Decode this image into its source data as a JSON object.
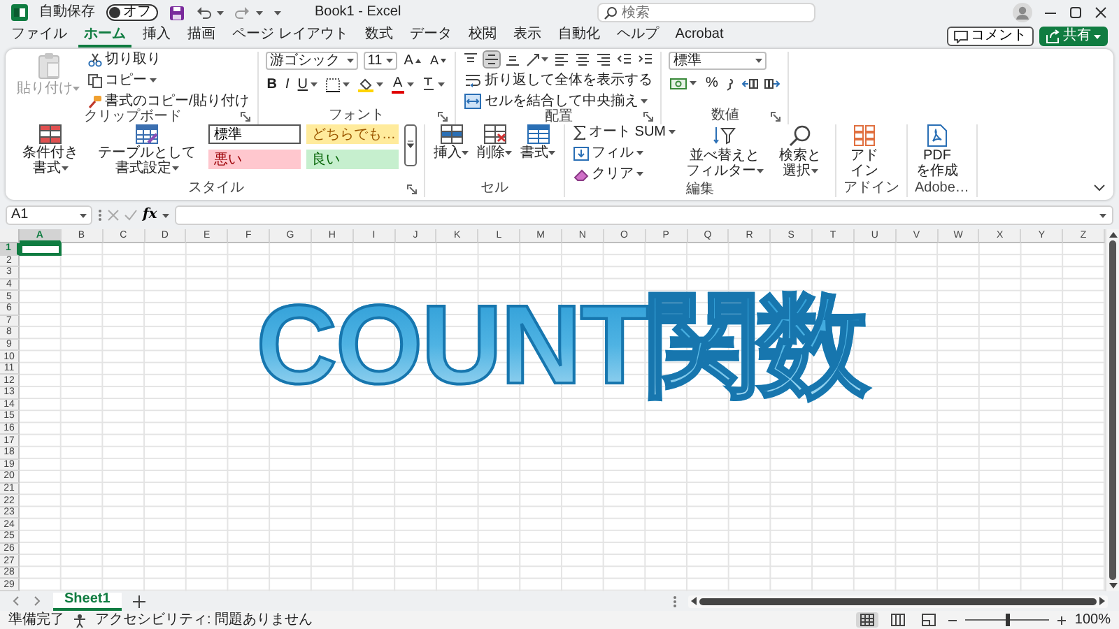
{
  "title_bar": {
    "autosave_label": "自動保存",
    "autosave": {
      "label": "オフ",
      "on": false
    },
    "document_title": "Book1 - Excel",
    "search": {
      "placeholder": "検索"
    }
  },
  "ribbon_tabs": [
    {
      "label": "ファイル",
      "selected": false
    },
    {
      "label": "ホーム",
      "selected": true
    },
    {
      "label": "挿入",
      "selected": false
    },
    {
      "label": "描画",
      "selected": false
    },
    {
      "label": "ページ レイアウト",
      "selected": false
    },
    {
      "label": "数式",
      "selected": false
    },
    {
      "label": "データ",
      "selected": false
    },
    {
      "label": "校閲",
      "selected": false
    },
    {
      "label": "表示",
      "selected": false
    },
    {
      "label": "自動化",
      "selected": false
    },
    {
      "label": "ヘルプ",
      "selected": false
    },
    {
      "label": "Acrobat",
      "selected": false
    }
  ],
  "ribbon_actions": {
    "comment": "コメント",
    "share": "共有"
  },
  "ribbon": {
    "clipboard": {
      "label": "クリップボード",
      "paste": {
        "label": "貼り付け",
        "disabled": true
      },
      "cut": "切り取り",
      "copy": "コピー",
      "format_painter": "書式のコピー/貼り付け"
    },
    "font": {
      "label": "フォント",
      "font_name": "游ゴシック",
      "font_size": "11",
      "grow": "A",
      "shrink": "A",
      "bold": "B",
      "italic": "I",
      "underline": "U",
      "font_color": "A"
    },
    "alignment": {
      "label": "配置",
      "vertical_align": [
        {
          "selected": false
        },
        {
          "selected": true
        },
        {
          "selected": false
        }
      ],
      "wrap_text": "折り返して全体を表示する",
      "merge_center": "セルを結合して中央揃え"
    },
    "number": {
      "label": "数値",
      "format": "標準",
      "percent": "%"
    },
    "styles": {
      "label": "スタイル",
      "conditional": "条件付き書式",
      "format_table": "テーブルとして書式設定",
      "cell_styles": [
        {
          "label": "標準",
          "kind": "normal"
        },
        {
          "label": "どちらでも…",
          "kind": "neutral"
        },
        {
          "label": "悪い",
          "kind": "bad"
        },
        {
          "label": "良い",
          "kind": "good"
        }
      ]
    },
    "cells": {
      "label": "セル",
      "insert": "挿入",
      "delete": "削除",
      "format": "書式"
    },
    "editing": {
      "label": "編集",
      "autosum": "オート SUM",
      "fill": "フィル",
      "clear": "クリア",
      "sort_filter": "並べ替えとフィルター",
      "find_select": "検索と選択"
    },
    "addins": {
      "label": "アドイン",
      "button": "アドイン"
    },
    "adobe": {
      "label": "Adobe…",
      "button": "PDF\nを作成"
    }
  },
  "formula_bar": {
    "name_box": "A1",
    "function_label": "fx"
  },
  "sheet": {
    "columns": [
      {
        "label": "A",
        "selected": true
      },
      {
        "label": "B",
        "selected": false
      },
      {
        "label": "C",
        "selected": false
      },
      {
        "label": "D",
        "selected": false
      },
      {
        "label": "E",
        "selected": false
      },
      {
        "label": "F",
        "selected": false
      },
      {
        "label": "G",
        "selected": false
      },
      {
        "label": "H",
        "selected": false
      },
      {
        "label": "I",
        "selected": false
      },
      {
        "label": "J",
        "selected": false
      },
      {
        "label": "K",
        "selected": false
      },
      {
        "label": "L",
        "selected": false
      },
      {
        "label": "M",
        "selected": false
      },
      {
        "label": "N",
        "selected": false
      },
      {
        "label": "O",
        "selected": false
      },
      {
        "label": "P",
        "selected": false
      },
      {
        "label": "Q",
        "selected": false
      },
      {
        "label": "R",
        "selected": false
      },
      {
        "label": "S",
        "selected": false
      },
      {
        "label": "T",
        "selected": false
      },
      {
        "label": "U",
        "selected": false
      },
      {
        "label": "V",
        "selected": false
      },
      {
        "label": "W",
        "selected": false
      },
      {
        "label": "X",
        "selected": false
      },
      {
        "label": "Y",
        "selected": false
      },
      {
        "label": "Z",
        "selected": false
      }
    ],
    "rows": [
      {
        "label": "1",
        "selected": true
      },
      {
        "label": "2",
        "selected": false
      },
      {
        "label": "3",
        "selected": false
      },
      {
        "label": "4",
        "selected": false
      },
      {
        "label": "5",
        "selected": false
      },
      {
        "label": "6",
        "selected": false
      },
      {
        "label": "7",
        "selected": false
      },
      {
        "label": "8",
        "selected": false
      },
      {
        "label": "9",
        "selected": false
      },
      {
        "label": "10",
        "selected": false
      },
      {
        "label": "11",
        "selected": false
      },
      {
        "label": "12",
        "selected": false
      },
      {
        "label": "13",
        "selected": false
      },
      {
        "label": "14",
        "selected": false
      },
      {
        "label": "15",
        "selected": false
      },
      {
        "label": "16",
        "selected": false
      },
      {
        "label": "17",
        "selected": false
      },
      {
        "label": "18",
        "selected": false
      },
      {
        "label": "19",
        "selected": false
      },
      {
        "label": "20",
        "selected": false
      },
      {
        "label": "21",
        "selected": false
      },
      {
        "label": "22",
        "selected": false
      },
      {
        "label": "23",
        "selected": false
      },
      {
        "label": "24",
        "selected": false
      },
      {
        "label": "25",
        "selected": false
      },
      {
        "label": "26",
        "selected": false
      },
      {
        "label": "27",
        "selected": false
      },
      {
        "label": "28",
        "selected": false
      },
      {
        "label": "29",
        "selected": false
      }
    ]
  },
  "overlay_title": "COUNT関数",
  "sheet_tabs": [
    {
      "label": "Sheet1",
      "selected": true
    }
  ],
  "status_bar": {
    "ready": "準備完了",
    "accessibility": "アクセシビリティ: 問題ありません",
    "views": [
      {
        "selected": true
      },
      {
        "selected": false
      },
      {
        "selected": false
      }
    ],
    "zoom": {
      "level": 0.5,
      "reading": "100%"
    }
  }
}
